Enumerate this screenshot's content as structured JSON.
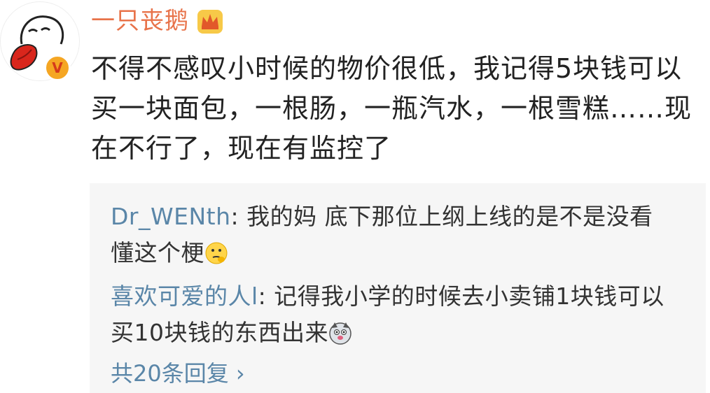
{
  "post": {
    "username": "一只丧鹅",
    "text_line1": "不得不感叹小时候的物价很低，我记得5块钱可以",
    "text_line2": "买一块面包，一根肠，一瓶汽水，一根雪糕……现",
    "text_line3": "在不行了，现在有监控了",
    "avatar_icon": "goose-icon",
    "badge_icon": "verified-badge-icon",
    "vip_icon": "crown-icon",
    "verified_mark": "V"
  },
  "replies": [
    {
      "name": "Dr_WENth",
      "text_part1": ": 我的妈 底下那位上纲上线的是不是没看",
      "text_part2": "懂这个梗",
      "emoji": "thinking-face-icon"
    },
    {
      "name": "喜欢可爱的人l",
      "text_part1": ": 记得我小学的时候去小卖铺1块钱可以",
      "text_part2": "买10块钱的东西出来",
      "emoji": "husky-face-icon"
    }
  ],
  "more_replies": "共20条回复 ›",
  "colors": {
    "username": "#e8734a",
    "reply_name": "#5a86a8",
    "reply_bg": "#f6f6f6"
  }
}
